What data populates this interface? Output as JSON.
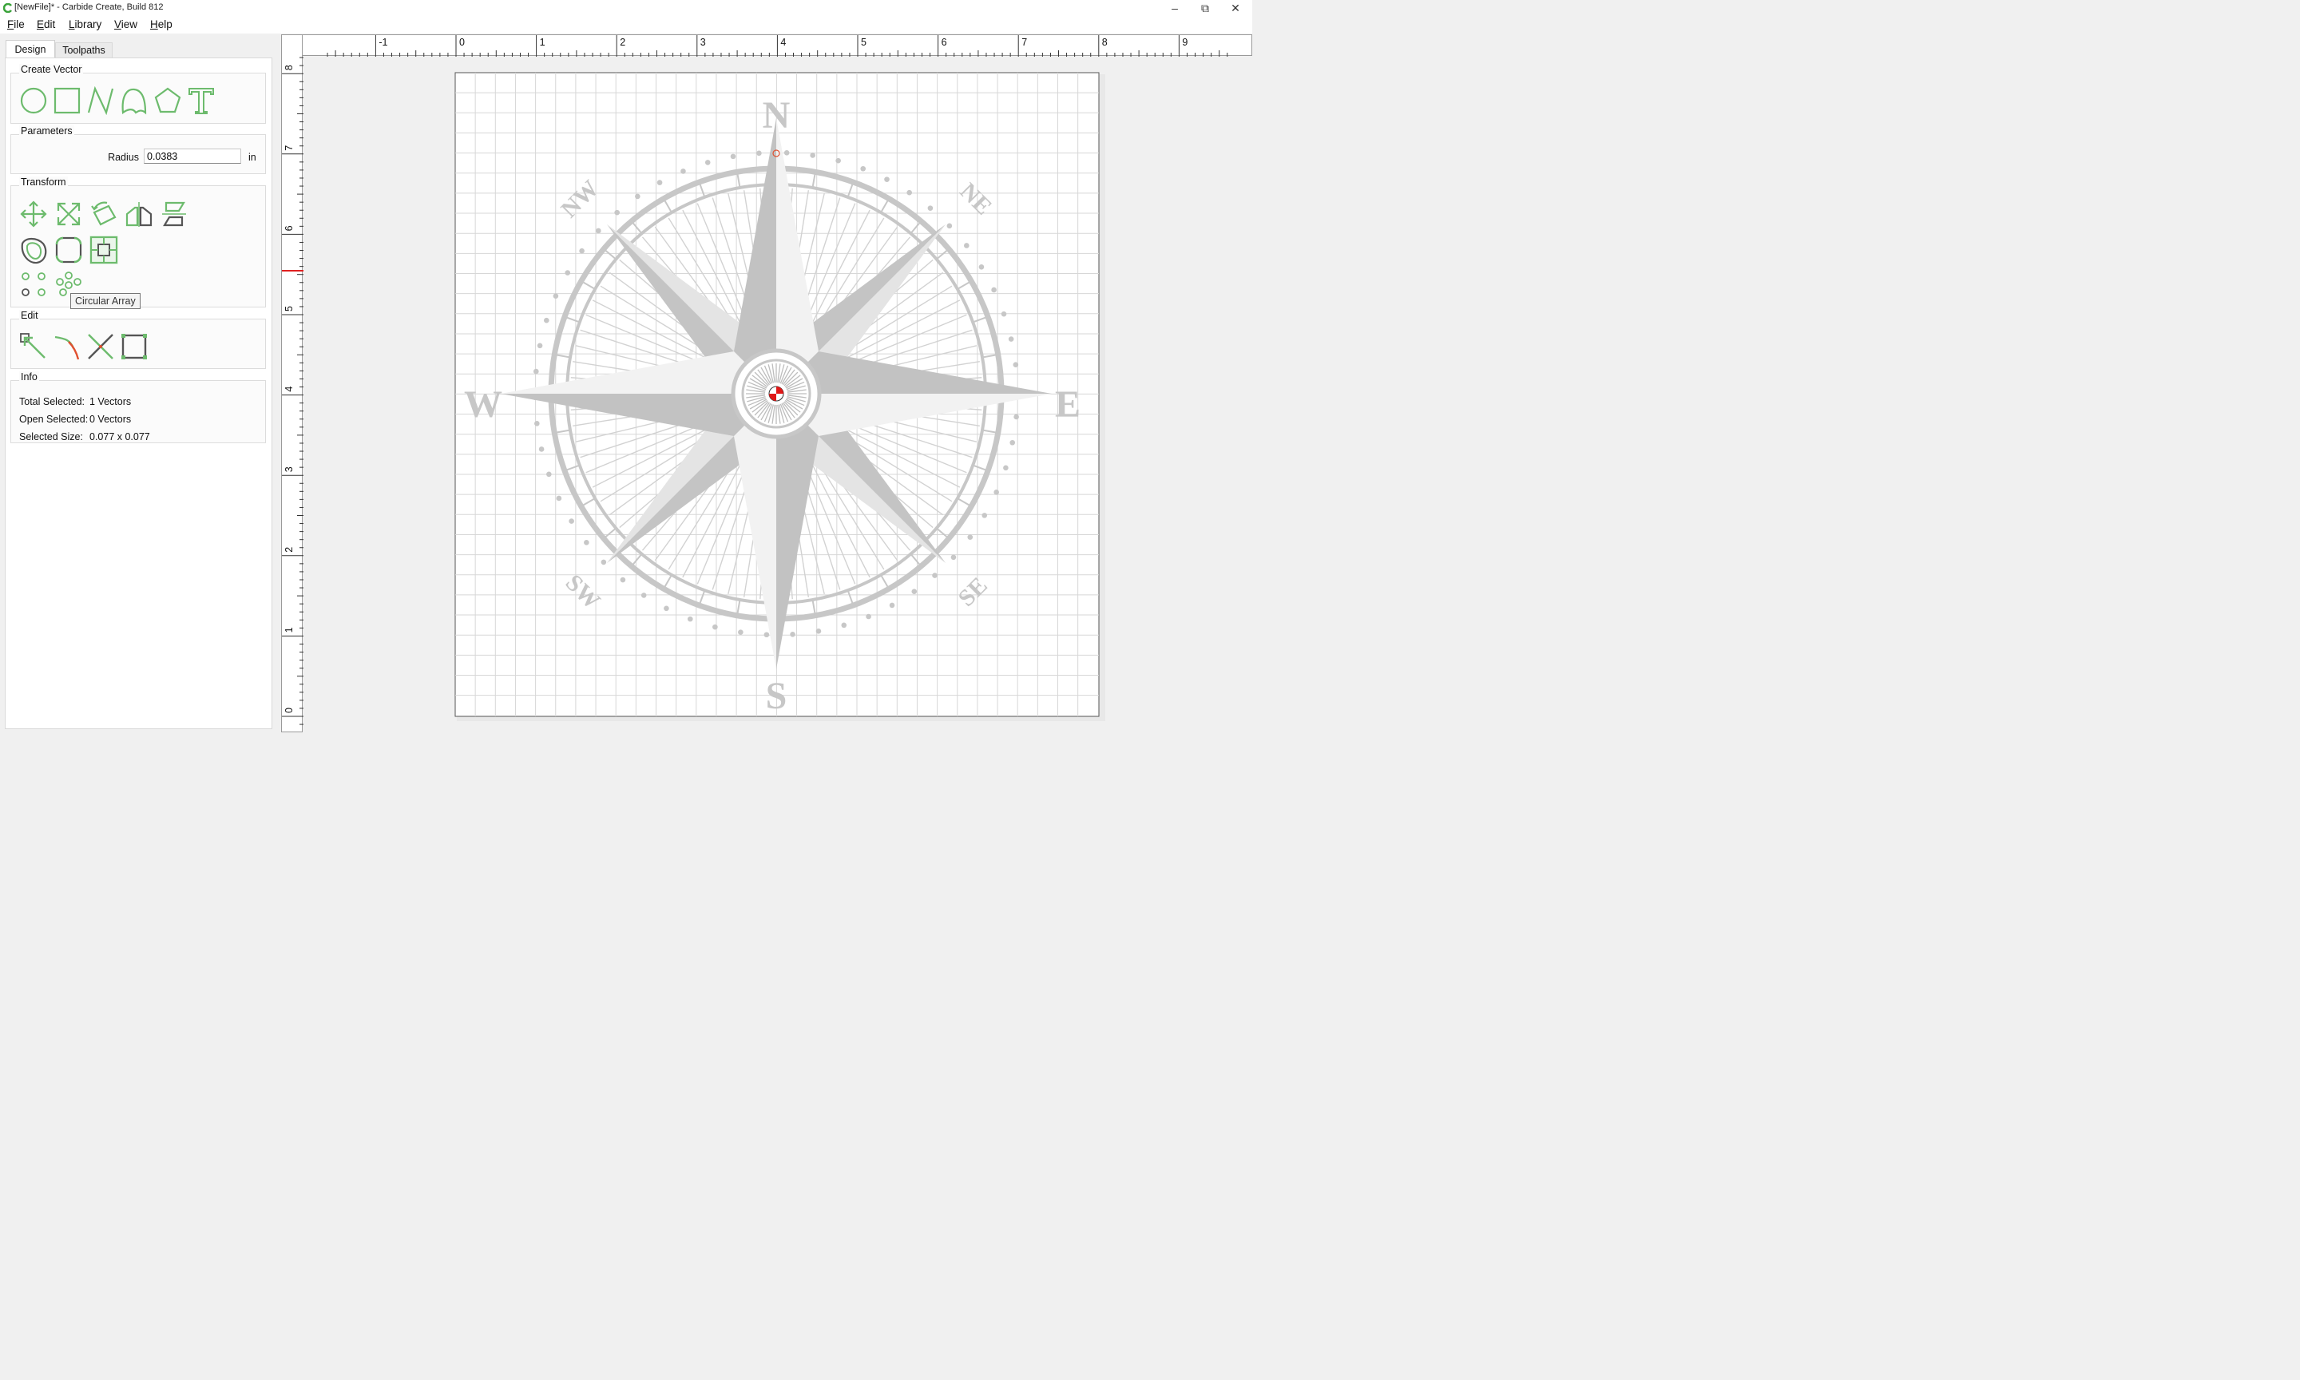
{
  "window": {
    "title": "[NewFile]* - Carbide Create, Build 812"
  },
  "menu": [
    {
      "label": "File",
      "key": "F",
      "rest": "ile"
    },
    {
      "label": "Edit",
      "key": "E",
      "rest": "dit"
    },
    {
      "label": "Library",
      "key": "L",
      "rest": "ibrary"
    },
    {
      "label": "View",
      "key": "V",
      "rest": "iew"
    },
    {
      "label": "Help",
      "key": "H",
      "rest": "elp"
    }
  ],
  "tabs": {
    "design": "Design",
    "toolpaths": "Toolpaths"
  },
  "create_vector": {
    "title": "Create Vector",
    "tools": [
      "circle-icon",
      "rectangle-icon",
      "polyline-icon",
      "curve-icon",
      "polygon-icon",
      "text-icon"
    ]
  },
  "parameters": {
    "title": "Parameters",
    "radius_label": "Radius",
    "radius_value": "0.0383",
    "unit": "in"
  },
  "transform": {
    "title": "Transform",
    "tools": [
      "move-icon",
      "scale-icon",
      "rotate-icon",
      "mirror-icon",
      "align-icon",
      "offset-icon",
      "fillet-icon",
      "center-icon",
      "grid-array-icon",
      "circular-array-icon"
    ],
    "tooltip": "Circular Array"
  },
  "edit": {
    "title": "Edit",
    "tools": [
      "node-edit-icon",
      "trim-icon",
      "join-icon",
      "boolean-icon"
    ]
  },
  "info": {
    "title": "Info",
    "rows": [
      {
        "label": "Total Selected:",
        "value": "1 Vectors"
      },
      {
        "label": "Open Selected:",
        "value": "0 Vectors"
      },
      {
        "label": "Selected Size:",
        "value": "0.077 x 0.077"
      }
    ]
  },
  "ruler": {
    "x_labels": [
      "-1",
      "0",
      "1",
      "2",
      "3",
      "4",
      "5",
      "6",
      "7",
      "8",
      "9"
    ],
    "y_labels": [
      "8",
      "7",
      "6",
      "5",
      "4",
      "3",
      "2",
      "1",
      "0"
    ]
  },
  "compass": {
    "labels": [
      "N",
      "S",
      "E",
      "W",
      "NE",
      "NW",
      "SE",
      "SW"
    ]
  },
  "colors": {
    "accent": "#6dbb6d",
    "ruler_marker": "#e02020",
    "artwork": "#c7c7c7"
  }
}
